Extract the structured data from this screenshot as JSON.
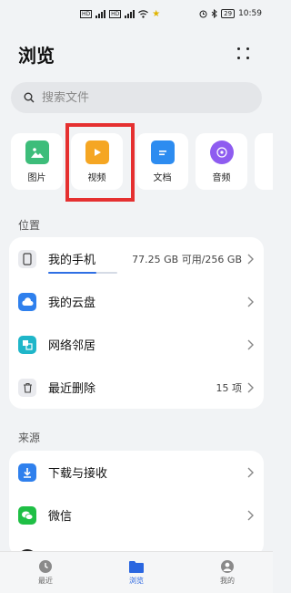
{
  "status_bar": {
    "tag1": "HD",
    "tag2": "HD",
    "battery": "29",
    "time": "10:59"
  },
  "header": {
    "title": "浏览"
  },
  "search": {
    "placeholder": "搜索文件"
  },
  "categories": [
    {
      "label": "图片",
      "icon": "image-icon",
      "color": "#3dbd7a"
    },
    {
      "label": "视频",
      "icon": "video-icon",
      "color": "#f5a623"
    },
    {
      "label": "文档",
      "icon": "document-icon",
      "color": "#2d8cf0"
    },
    {
      "label": "音频",
      "icon": "audio-icon",
      "color": "#8e5cf0"
    }
  ],
  "location_section": {
    "label": "位置",
    "items": [
      {
        "label": "我的手机",
        "value": "77.25 GB 可用/256 GB",
        "icon": "phone-icon",
        "usage_fraction": 0.7
      },
      {
        "label": "我的云盘",
        "value": "",
        "icon": "cloud-icon"
      },
      {
        "label": "网络邻居",
        "value": "",
        "icon": "network-icon"
      },
      {
        "label": "最近删除",
        "value": "15 项",
        "icon": "trash-icon"
      }
    ]
  },
  "source_section": {
    "label": "来源",
    "items": [
      {
        "label": "下载与接收",
        "icon": "download-icon"
      },
      {
        "label": "微信",
        "icon": "wechat-icon"
      }
    ]
  },
  "bottom_nav": [
    {
      "label": "最近",
      "icon": "clock-icon",
      "active": false
    },
    {
      "label": "浏览",
      "icon": "folder-icon",
      "active": true
    },
    {
      "label": "我的",
      "icon": "profile-icon",
      "active": false
    }
  ],
  "colors": {
    "accent": "#2a66e0",
    "highlight": "#e53030",
    "background": "#f1f3f5"
  }
}
